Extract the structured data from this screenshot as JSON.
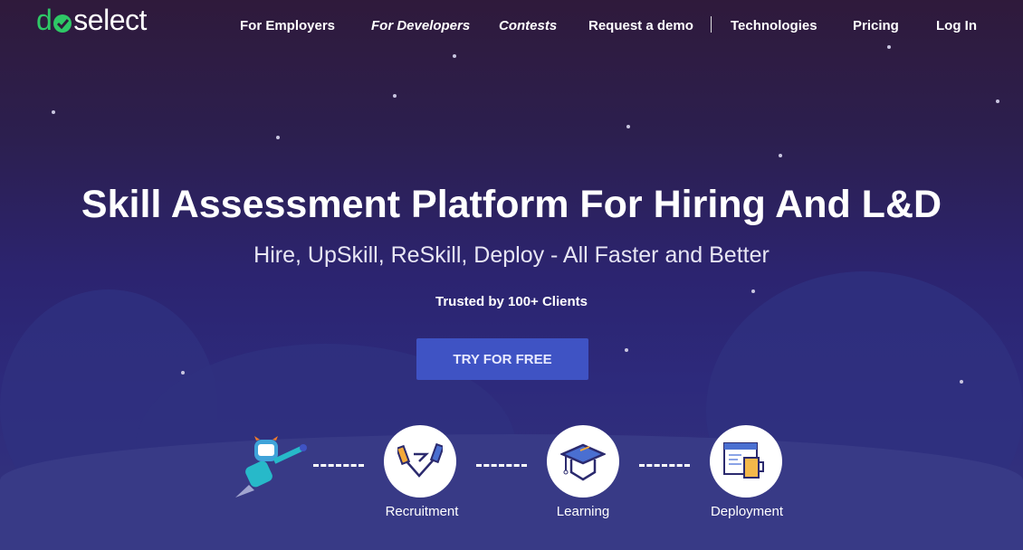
{
  "logo": {
    "prefix": "d",
    "suffix": "select",
    "brand_color": "#2ec866"
  },
  "nav": {
    "items": [
      "For Employers",
      "For Developers",
      "Contests",
      "Request a demo",
      "Technologies",
      "Pricing",
      "Log In"
    ]
  },
  "hero": {
    "title": "Skill Assessment Platform For Hiring And L&D",
    "subtitle": "Hire, UpSkill, ReSkill, Deploy - All Faster and Better",
    "trusted": "Trusted by 100+ Clients",
    "cta": "TRY FOR FREE"
  },
  "steps": [
    {
      "label": "Recruitment",
      "icon": "handshake-icon"
    },
    {
      "label": "Learning",
      "icon": "graduation-cap-icon"
    },
    {
      "label": "Deployment",
      "icon": "code-window-mug-icon"
    }
  ]
}
